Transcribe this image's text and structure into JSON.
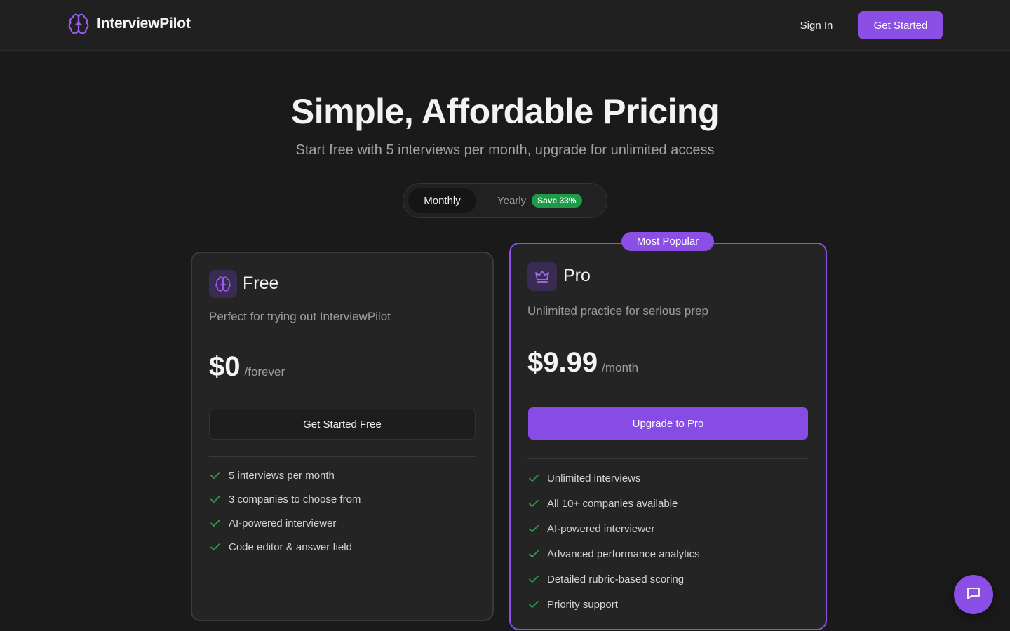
{
  "colors": {
    "accent": "#8b4fe6",
    "save_badge": "#1f9a48",
    "check": "#2ea44f",
    "background": "#1b1a1a"
  },
  "header": {
    "brand_icon": "brain-icon",
    "brand_name": "InterviewPilot",
    "signin_label": "Sign In",
    "getstarted_label": "Get Started"
  },
  "hero": {
    "title": "Simple, Affordable Pricing",
    "subtitle": "Start free with 5 interviews per month, upgrade for unlimited access"
  },
  "billing_toggle": {
    "monthly_label": "Monthly",
    "yearly_label": "Yearly",
    "save_badge": "Save 33%",
    "selected": "Monthly"
  },
  "plans": {
    "free": {
      "icon": "brain-icon",
      "name": "Free",
      "description": "Perfect for trying out InterviewPilot",
      "price": "$0",
      "period": "/forever",
      "cta": "Get Started Free",
      "features": [
        "5 interviews per month",
        "3 companies to choose from",
        "AI-powered interviewer",
        "Code editor & answer field"
      ]
    },
    "pro": {
      "icon": "crown-icon",
      "badge": "Most Popular",
      "name": "Pro",
      "description": "Unlimited practice for serious prep",
      "price": "$9.99",
      "period": "/month",
      "cta": "Upgrade to Pro",
      "features": [
        "Unlimited interviews",
        "All 10+ companies available",
        "AI-powered interviewer",
        "Advanced performance analytics",
        "Detailed rubric-based scoring",
        "Priority support"
      ]
    }
  },
  "chat": {
    "icon": "chat-icon"
  }
}
